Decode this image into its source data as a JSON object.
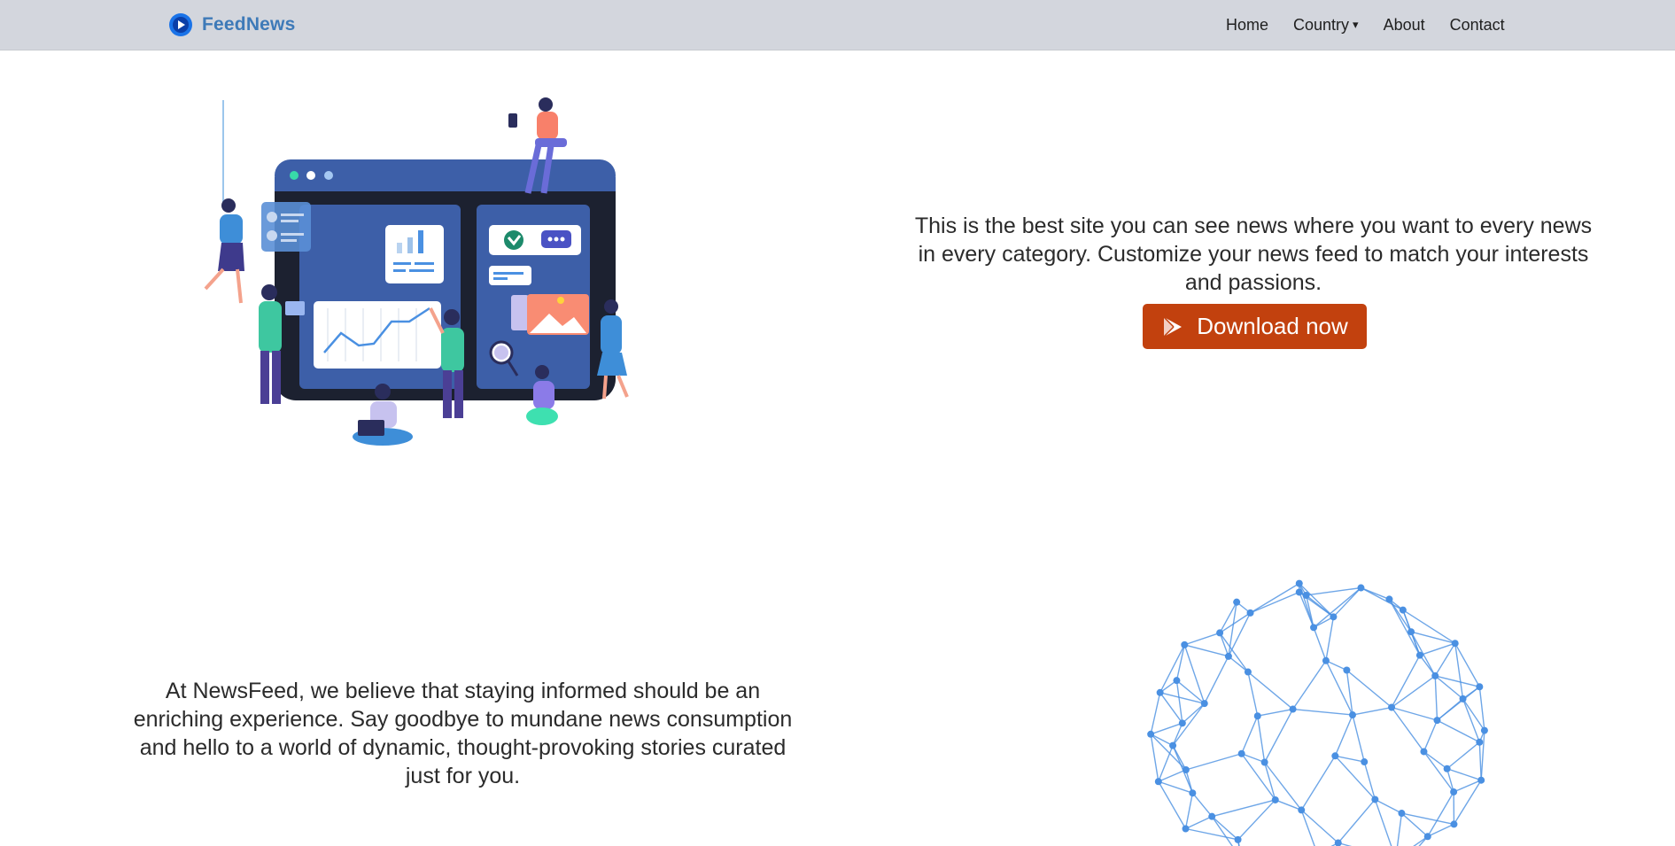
{
  "navbar": {
    "brand": "FeedNews",
    "links": [
      {
        "label": "Home"
      },
      {
        "label": "Country",
        "caret": "▾"
      },
      {
        "label": "About"
      },
      {
        "label": "Contact"
      }
    ]
  },
  "hero": {
    "text": "This is the best site you can see news where you want to every news in every category. Customize your news feed to match your interests and passions.",
    "download_label": "Download now"
  },
  "about": {
    "text": "At NewsFeed, we believe that staying informed should be an enriching experience. Say goodbye to mundane news consumption and hello to a world of dynamic, thought-provoking stories curated just for you."
  },
  "colors": {
    "navbar_bg": "#d3d6dd",
    "brand": "#3e7ab8",
    "download_button": "#c2410e",
    "globe": "#4a90e2"
  },
  "icons": {
    "brand": "play-circle-icon",
    "download": "google-play-icon"
  }
}
